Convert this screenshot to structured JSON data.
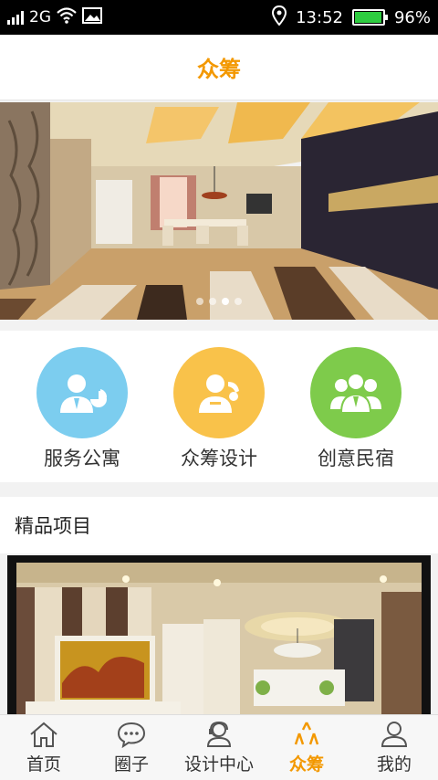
{
  "status_bar": {
    "network": "2G",
    "time": "13:52",
    "battery": "96%",
    "battery_level": 0.96,
    "icons": [
      "signal-icon",
      "wifi-icon",
      "image-icon",
      "location-icon",
      "battery-icon"
    ]
  },
  "header": {
    "title": "众筹"
  },
  "banner": {
    "slide_count": 4,
    "active_slide": 2
  },
  "categories": [
    {
      "label": "服务公寓",
      "icon": "user-chart-icon",
      "color": "#7ccdef"
    },
    {
      "label": "众筹设计",
      "icon": "user-phone-icon",
      "color": "#f9c24a"
    },
    {
      "label": "创意民宿",
      "icon": "users-group-icon",
      "color": "#7ecb4b"
    }
  ],
  "section": {
    "title": "精品项目"
  },
  "bottom_nav": {
    "active_index": 3,
    "active_color": "#f39800",
    "items": [
      {
        "label": "首页",
        "icon": "home-icon"
      },
      {
        "label": "圈子",
        "icon": "chat-icon"
      },
      {
        "label": "设计中心",
        "icon": "designer-icon"
      },
      {
        "label": "众筹",
        "icon": "crowdfunding-icon"
      },
      {
        "label": "我的",
        "icon": "profile-icon"
      }
    ]
  }
}
